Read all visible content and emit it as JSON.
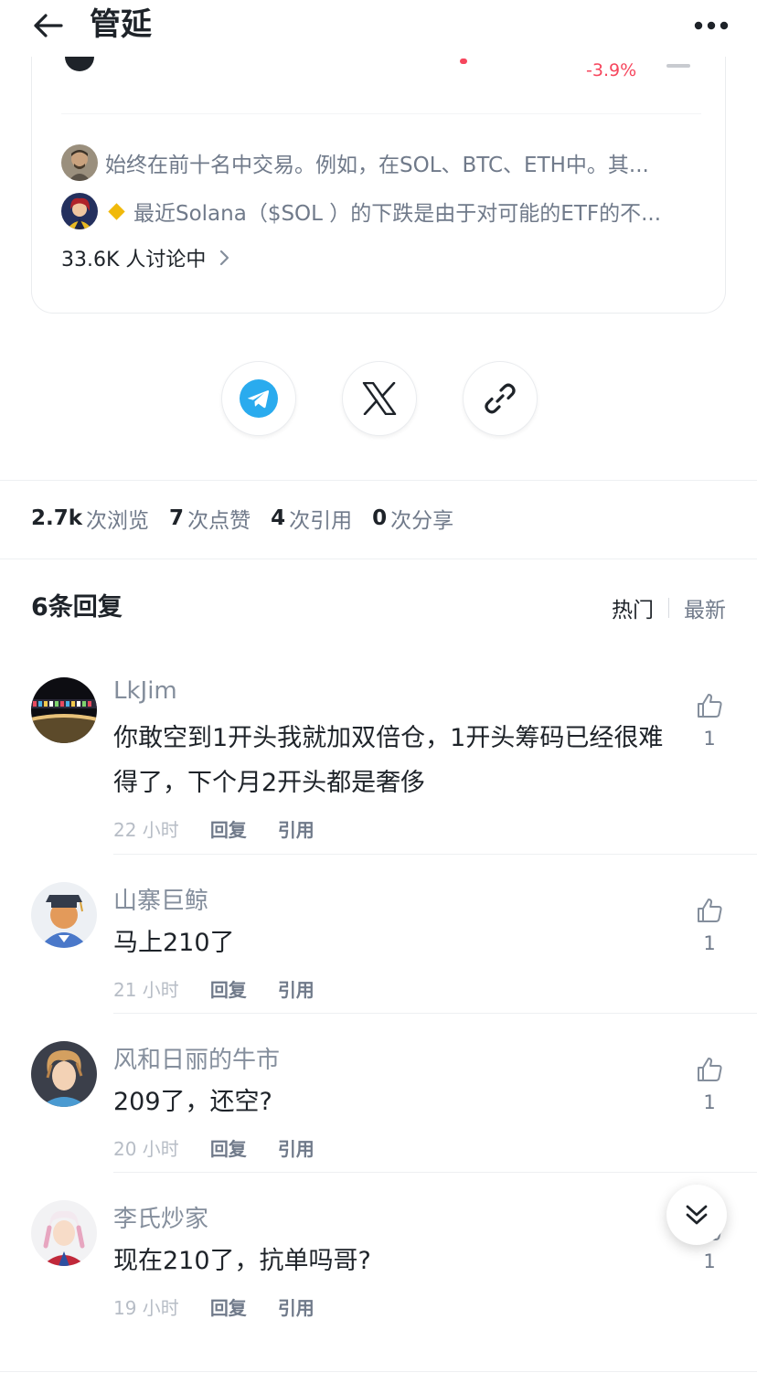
{
  "header": {
    "title": "管延"
  },
  "card": {
    "price_change": "-3.9%",
    "discussions": [
      {
        "text": "始终在前十名中交易。例如，在SOL、BTC、ETH中。其..."
      },
      {
        "text": "最近Solana（$SOL ）的下跌是由于对可能的ETF的不..."
      }
    ],
    "discussing_count": "33.6K 人讨论中"
  },
  "share": {
    "buttons": [
      "telegram-icon",
      "x-icon",
      "link-icon"
    ]
  },
  "stats": {
    "views_num": "2.7k",
    "views_label": "次浏览",
    "likes_num": "7",
    "likes_label": "次点赞",
    "quotes_num": "4",
    "quotes_label": "次引用",
    "shares_num": "0",
    "shares_label": "次分享"
  },
  "replies": {
    "title": "6条回复",
    "sort_hot": "热门",
    "sort_new": "最新",
    "reply_label": "回复",
    "quote_label": "引用",
    "items": [
      {
        "name": "LkJim",
        "text": "你敢空到1开头我就加双倍仓，1开头筹码已经很难得了，下个月2开头都是奢侈",
        "time": "22 小时",
        "likes": "1"
      },
      {
        "name": "山寨巨鲸",
        "text": "马上210了",
        "time": "21 小时",
        "likes": "1"
      },
      {
        "name": "风和日丽的牛市",
        "text": "209了，还空?",
        "time": "20 小时",
        "likes": "1"
      },
      {
        "name": "李氏炒家",
        "text": "现在210了，抗单吗哥?",
        "time": "19 小时",
        "likes": "1"
      }
    ]
  },
  "colors": {
    "negative": "#f6465d",
    "accent": "#f0b90b",
    "telegram": "#2aabee"
  }
}
